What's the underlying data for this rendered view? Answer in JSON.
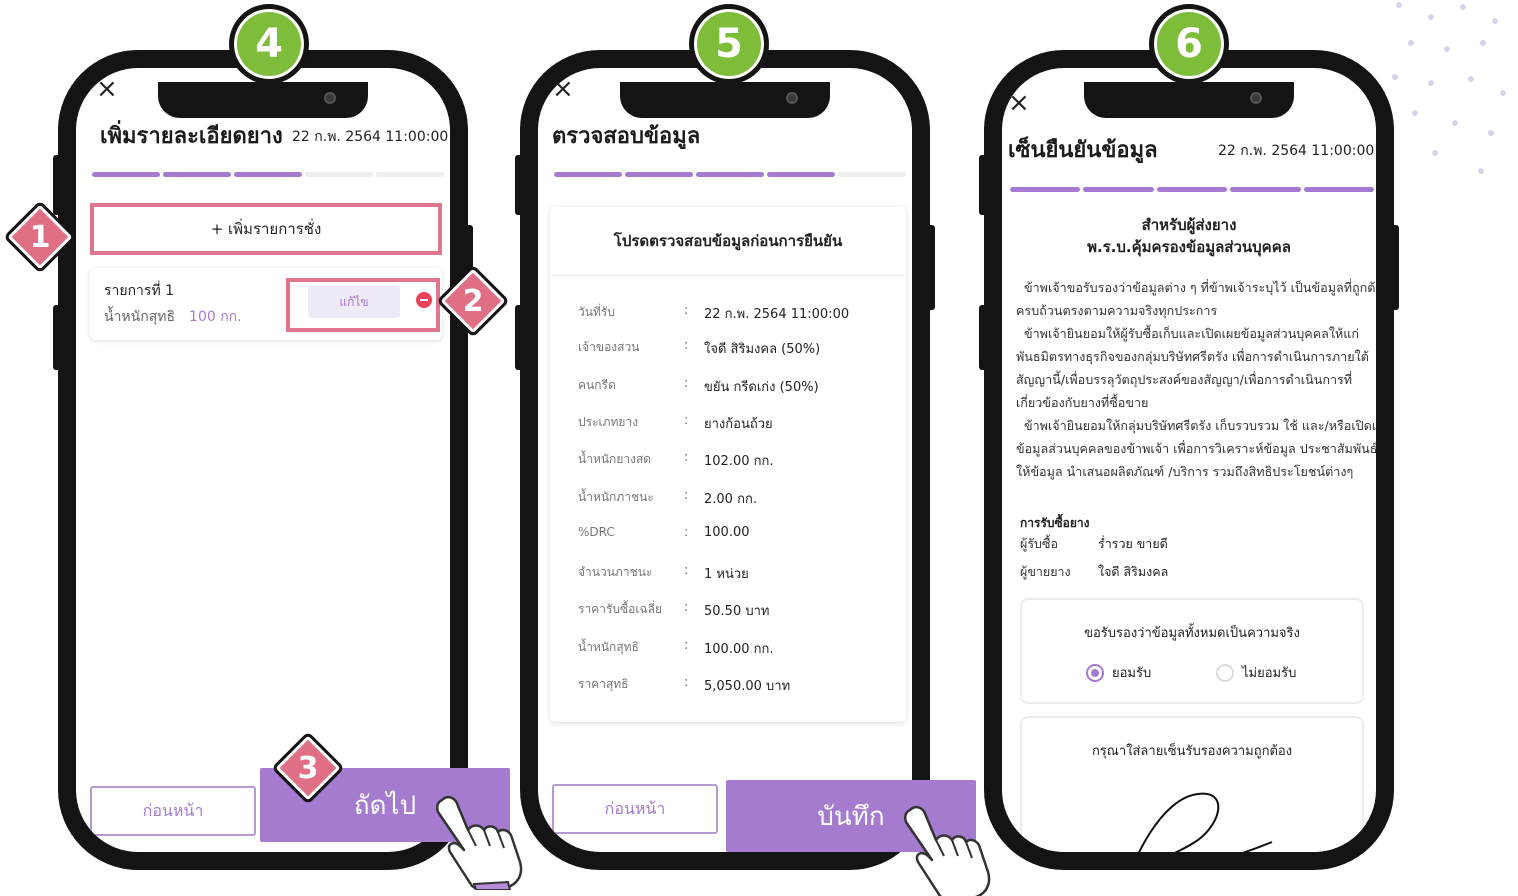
{
  "steps": [
    "4",
    "5",
    "6"
  ],
  "badges": [
    "1",
    "2",
    "3"
  ],
  "screen1": {
    "close": "×",
    "title": "เพิ่มรายละเอียดยาง",
    "date": "22 ก.พ. 2564  11:00:00",
    "progress_done": 3,
    "progress_total": 5,
    "add_button": "+ เพิ่มรายการชั่ง",
    "item": {
      "title": "รายการที่ 1",
      "weight_label": "น้ำหนักสุทธิ",
      "weight_value": "100 กก.",
      "edit": "แก้ไข"
    },
    "prev": "ก่อนหน้า",
    "next": "ถัดไป"
  },
  "screen2": {
    "close": "×",
    "title": "ตรวจสอบข้อมูล",
    "progress_done": 4,
    "progress_total": 5,
    "heading": "โปรดตรวจสอบข้อมูลก่อนการยืนยัน",
    "rows": [
      {
        "label": "วันที่รับ",
        "value": "22 ก.พ. 2564  11:00:00"
      },
      {
        "label": "เจ้าของสวน",
        "value": "ใจดี สิริมงคล   (50%)"
      },
      {
        "label": "คนกรีด",
        "value": "ขยัน กรีดเก่ง   (50%)"
      },
      {
        "label": "ประเภทยาง",
        "value": "ยางก้อนถ้วย"
      },
      {
        "label": "น้ำหนักยางสด",
        "value": "102.00 กก."
      },
      {
        "label": "น้ำหนักภาชนะ",
        "value": "2.00 กก."
      },
      {
        "label": "%DRC",
        "value": "100.00"
      },
      {
        "label": "จำนวนภาชนะ",
        "value": "1 หน่วย"
      },
      {
        "label": "ราคารับซื้อเฉลี่ย",
        "value": "50.50 บาท"
      },
      {
        "label": "น้ำหนักสุทธิ",
        "value": "100.00 กก."
      },
      {
        "label": "ราคาสุทธิ",
        "value": "5,050.00 บาท"
      }
    ],
    "colon": ":",
    "prev": "ก่อนหน้า",
    "save": "บันทึก"
  },
  "screen3": {
    "close": "×",
    "title": "เซ็นยืนยันข้อมูล",
    "date": "22 ก.พ. 2564  11:00:00",
    "progress_done": 5,
    "progress_total": 5,
    "consent_title_1": "สำหรับผู้ส่งยาง",
    "consent_title_2": "พ.ร.บ.คุ้มครองข้อมูลส่วนบุคคล",
    "consent_lines": [
      "  ข้าพเจ้าขอรับรองว่าข้อมูลต่าง ๆ ที่ข้าพเจ้าระบุไว้ เป็นข้อมูลที่ถูกต้อง",
      "ครบถ้วนตรงตามความจริงทุกประการ",
      "  ข้าพเจ้ายินยอมให้ผู้รับซื้อเก็บและเปิดเผยข้อมูลส่วนบุคคลให้แก่",
      "พันธมิตรทางธุรกิจของกลุ่มบริษัทศรีตรัง เพื่อการดำเนินการภายใต้",
      "สัญญานี้/เพื่อบรรลุวัตถุประสงค์ของสัญญา/เพื่อการดำเนินการที่",
      "เกี่ยวข้องกับยางที่ซื้อขาย",
      "  ข้าพเจ้ายินยอมให้กลุ่มบริษัทศรีตรัง เก็บรวบรวม ใช้ และ/หรือเปิดเผย",
      "ข้อมูลส่วนบุคคลของข้าพเจ้า เพื่อการวิเคราะห์ข้อมูล ประชาสัมพันธ์",
      "ให้ข้อมูล นำเสนอผลิตภัณฑ์ /บริการ รวมถึงสิทธิประโยชน์ต่างๆ"
    ],
    "buying_heading": "การรับซื้อยาง",
    "buyer_label": "ผู้รับซื้อ",
    "buyer_value": "ร่ำรวย  ขายดี",
    "seller_label": "ผู้ขายยาง",
    "seller_value": "ใจดี สิริมงคล",
    "confirm_question": "ขอรับรองว่าข้อมูลทั้งหมดเป็นความจริง",
    "accept": "ยอมรับ",
    "decline": "ไม่ยอมรับ",
    "accept_selected": true,
    "signature_prompt": "กรุณาใส่ลายเซ็นรับรองความถูกต้อง"
  },
  "colors": {
    "purple": "#a57bcf",
    "pink": "#e06f86",
    "green": "#7dbd3a",
    "frame": "#141414"
  }
}
